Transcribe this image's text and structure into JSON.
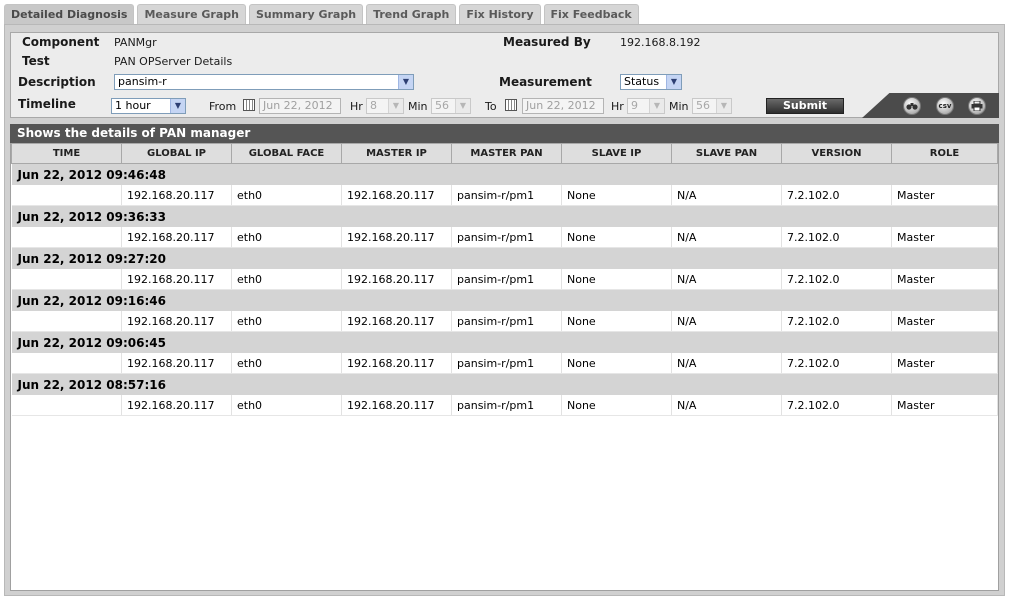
{
  "tabs": [
    {
      "label": "Detailed Diagnosis",
      "active": true
    },
    {
      "label": "Measure Graph"
    },
    {
      "label": "Summary Graph"
    },
    {
      "label": "Trend Graph"
    },
    {
      "label": "Fix History"
    },
    {
      "label": "Fix Feedback"
    }
  ],
  "form": {
    "component_label": "Component",
    "component_value": "PANMgr",
    "test_label": "Test",
    "test_value": "PAN OPServer Details",
    "description_label": "Description",
    "description_value": "pansim-r",
    "timeline_label": "Timeline",
    "timeline_value": "1 hour",
    "measured_by_label": "Measured By",
    "measured_by_value": "192.168.8.192",
    "measurement_label": "Measurement",
    "measurement_value": "Status",
    "from_label": "From",
    "from_date": "Jun 22, 2012",
    "from_hr_label": "Hr",
    "from_hr": "8",
    "from_min_label": "Min",
    "from_min": "56",
    "to_label": "To",
    "to_date": "Jun 22, 2012",
    "to_hr_label": "Hr",
    "to_hr": "9",
    "to_min_label": "Min",
    "to_min": "56",
    "submit_label": "Submit"
  },
  "toolbar_icons": [
    "binoculars-icon",
    "csv-icon",
    "print-icon"
  ],
  "toolbar_labels": {
    "csv": "csv"
  },
  "section_title": "Shows the details of PAN manager",
  "table": {
    "columns": [
      "TIME",
      "GLOBAL IP",
      "GLOBAL FACE",
      "MASTER IP",
      "MASTER PAN",
      "SLAVE IP",
      "SLAVE PAN",
      "VERSION",
      "ROLE"
    ],
    "groups": [
      {
        "time": "Jun 22, 2012 09:46:48",
        "row": [
          "192.168.20.117",
          "eth0",
          "192.168.20.117",
          "pansim-r/pm1",
          "None",
          "N/A",
          "7.2.102.0",
          "Master"
        ]
      },
      {
        "time": "Jun 22, 2012 09:36:33",
        "row": [
          "192.168.20.117",
          "eth0",
          "192.168.20.117",
          "pansim-r/pm1",
          "None",
          "N/A",
          "7.2.102.0",
          "Master"
        ]
      },
      {
        "time": "Jun 22, 2012 09:27:20",
        "row": [
          "192.168.20.117",
          "eth0",
          "192.168.20.117",
          "pansim-r/pm1",
          "None",
          "N/A",
          "7.2.102.0",
          "Master"
        ]
      },
      {
        "time": "Jun 22, 2012 09:16:46",
        "row": [
          "192.168.20.117",
          "eth0",
          "192.168.20.117",
          "pansim-r/pm1",
          "None",
          "N/A",
          "7.2.102.0",
          "Master"
        ]
      },
      {
        "time": "Jun 22, 2012 09:06:45",
        "row": [
          "192.168.20.117",
          "eth0",
          "192.168.20.117",
          "pansim-r/pm1",
          "None",
          "N/A",
          "7.2.102.0",
          "Master"
        ]
      },
      {
        "time": "Jun 22, 2012 08:57:16",
        "row": [
          "192.168.20.117",
          "eth0",
          "192.168.20.117",
          "pansim-r/pm1",
          "None",
          "N/A",
          "7.2.102.0",
          "Master"
        ]
      }
    ]
  }
}
